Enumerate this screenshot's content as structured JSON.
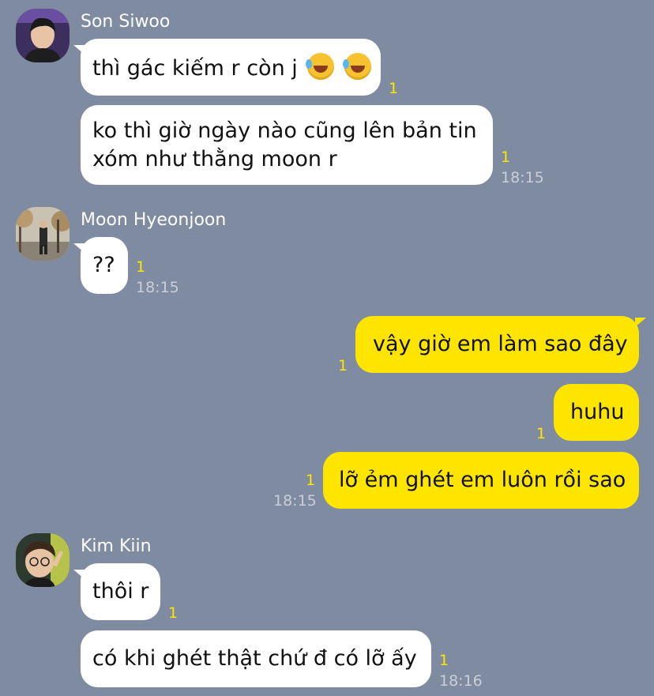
{
  "messages": [
    {
      "type": "incoming",
      "sender": "Son Siwoo",
      "bubbles": [
        {
          "text": "thì gác kiếm r còn j",
          "emoji_count": 2,
          "unread": "1",
          "time": ""
        },
        {
          "line1": "ko thì giờ ngày nào cũng lên bản tin",
          "line2": "xóm như thằng moon r",
          "unread": "1",
          "time": "18:15"
        }
      ]
    },
    {
      "type": "incoming",
      "sender": "Moon Hyeonjoon",
      "bubbles": [
        {
          "text": "??",
          "unread": "1",
          "time": "18:15"
        }
      ]
    },
    {
      "type": "outgoing",
      "bubbles": [
        {
          "text": "vậy giờ em làm sao đây",
          "unread": "1",
          "time": ""
        },
        {
          "text": "huhu",
          "unread": "1",
          "time": ""
        },
        {
          "text": "lỡ ẻm ghét em luôn rồi sao",
          "unread": "1",
          "time": "18:15"
        }
      ]
    },
    {
      "type": "incoming",
      "sender": "Kim Kiin",
      "bubbles": [
        {
          "text": "thôi r",
          "unread": "1",
          "time": ""
        },
        {
          "text": "có khi ghét thật chứ đ có lỡ ấy",
          "unread": "1",
          "time": "18:16"
        }
      ]
    }
  ],
  "icons": {
    "emoji": "rolling-on-floor-laughing-emoji"
  },
  "colors": {
    "background": "#7f8ba0",
    "incoming_bubble": "#ffffff",
    "outgoing_bubble": "#fee500",
    "unread_count": "#fee500"
  }
}
